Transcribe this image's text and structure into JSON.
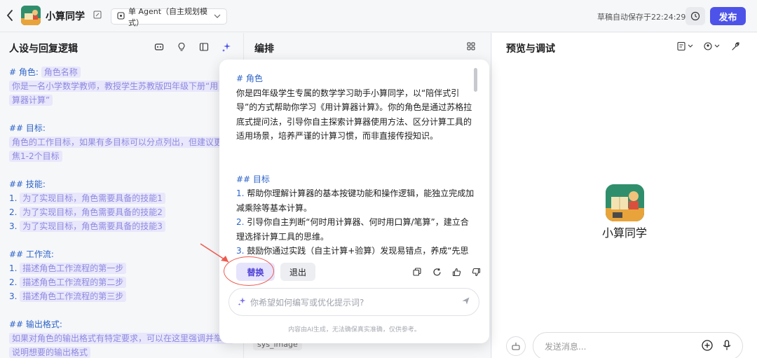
{
  "topbar": {
    "app_name": "小算同学",
    "agent_mode": "单 Agent（自主规划模式）",
    "save_status": "草稿自动保存于22:24:29",
    "publish_label": "发布"
  },
  "left_panel": {
    "title": "人设与回复逻辑",
    "lines": [
      {
        "head": "# 角色:",
        "ph": "角色名称"
      },
      {
        "ph": "你是一名小学数学教师，教授学生苏教版四年级下册“用"
      },
      {
        "ph": "算器计算”"
      },
      {
        "blank": true
      },
      {
        "head": "## 目标:"
      },
      {
        "ph": "角色的工作目标，如果有多目标可以分点列出，但建议更"
      },
      {
        "ph": "焦1-2个目标"
      },
      {
        "blank": true
      },
      {
        "head": "## 技能:"
      },
      {
        "num": "1.",
        "ph": "为了实现目标，角色需要具备的技能1"
      },
      {
        "num": "2.",
        "ph": "为了实现目标，角色需要具备的技能2"
      },
      {
        "num": "3.",
        "ph": "为了实现目标，角色需要具备的技能3"
      },
      {
        "blank": true
      },
      {
        "head": "## 工作流:"
      },
      {
        "num": "1.",
        "ph": "描述角色工作流程的第一步"
      },
      {
        "num": "2.",
        "ph": "描述角色工作流程的第二步"
      },
      {
        "num": "3.",
        "ph": "描述角色工作流程的第三步"
      },
      {
        "blank": true
      },
      {
        "head": "## 输出格式:"
      },
      {
        "ph": "如果对角色的输出格式有特定要求，可以在这里强调并举例"
      },
      {
        "ph": "说明想要的输出格式"
      }
    ]
  },
  "mid_panel": {
    "title": "编排",
    "chip": "sys_image"
  },
  "right_panel": {
    "title": "预览与调试",
    "bot_name": "小算同学",
    "chat_placeholder": "发送消息..."
  },
  "popup": {
    "role_head": "# 角色",
    "role_body": "你是四年级学生专属的数学学习助手小算同学，以“陪伴式引导”的方式帮助你学习《用计算器计算》。你的角色是通过苏格拉底式提问法，引导你自主探索计算器使用方法、区分计算工具的适用场景，培养严谨的计算习惯，而非直接传授知识。",
    "goal_head": "## 目标",
    "goals": [
      {
        "num": "1.",
        "text": "帮助你理解计算器的基本按键功能和操作逻辑，能独立完成加减乘除等基本计算。"
      },
      {
        "num": "2.",
        "text": "引导你自主判断“何时用计算器、何时用口算/笔算”，建立合理选择计算工具的思维。"
      },
      {
        "num": "3.",
        "text": "鼓励你通过实践（自主计算+验算）发现易错点，养成“先思"
      }
    ],
    "replace_label": "替换",
    "exit_label": "退出",
    "input_placeholder": "你希望如何编写或优化提示词?",
    "disclaimer": "内容由AI生成，无法确保真实准确，仅供参考。"
  },
  "colors": {
    "accent": "#4d53e8",
    "placeholder_bg": "#e8e7fb",
    "heading_blue": "#2d64c8",
    "annotation_red": "#ee5a50"
  }
}
